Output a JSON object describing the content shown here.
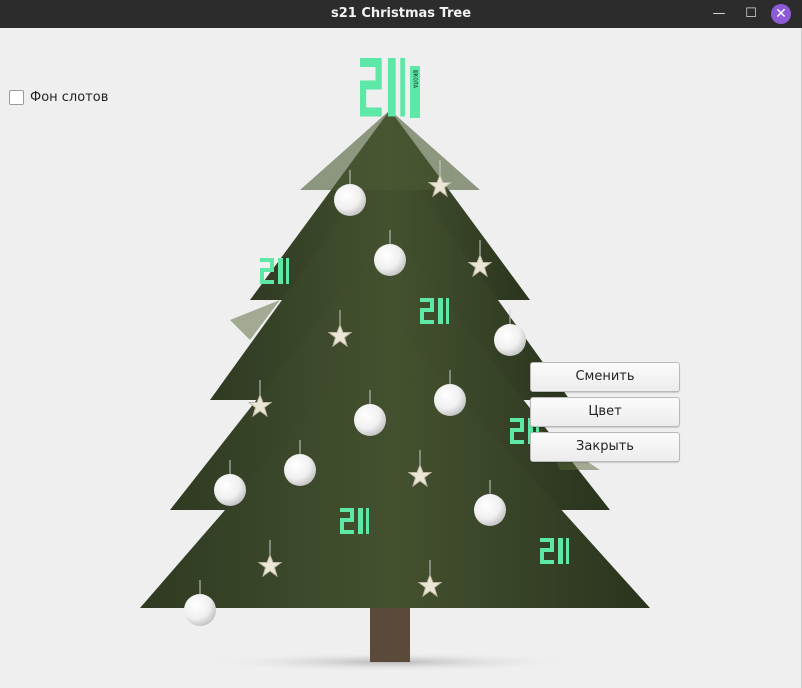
{
  "window": {
    "title": "s21 Christmas Tree",
    "controls": {
      "minimize": "—",
      "maximize": "☐",
      "close": "✕"
    }
  },
  "options": {
    "slot_background_label": "Фон слотов",
    "slot_background_checked": false
  },
  "context_menu": {
    "change_label": "Сменить",
    "color_label": "Цвет",
    "close_label": "Закрыть"
  },
  "decorations": {
    "top_badge_text": "21",
    "top_badge_side_text": "ШКОЛА",
    "badge_text": "21",
    "colors": {
      "badge": "#5de8a8",
      "ball": "#f4f4f4",
      "star": "#ebe6d6",
      "tree": "#3d4a2c",
      "trunk": "#5b4a3a"
    }
  }
}
